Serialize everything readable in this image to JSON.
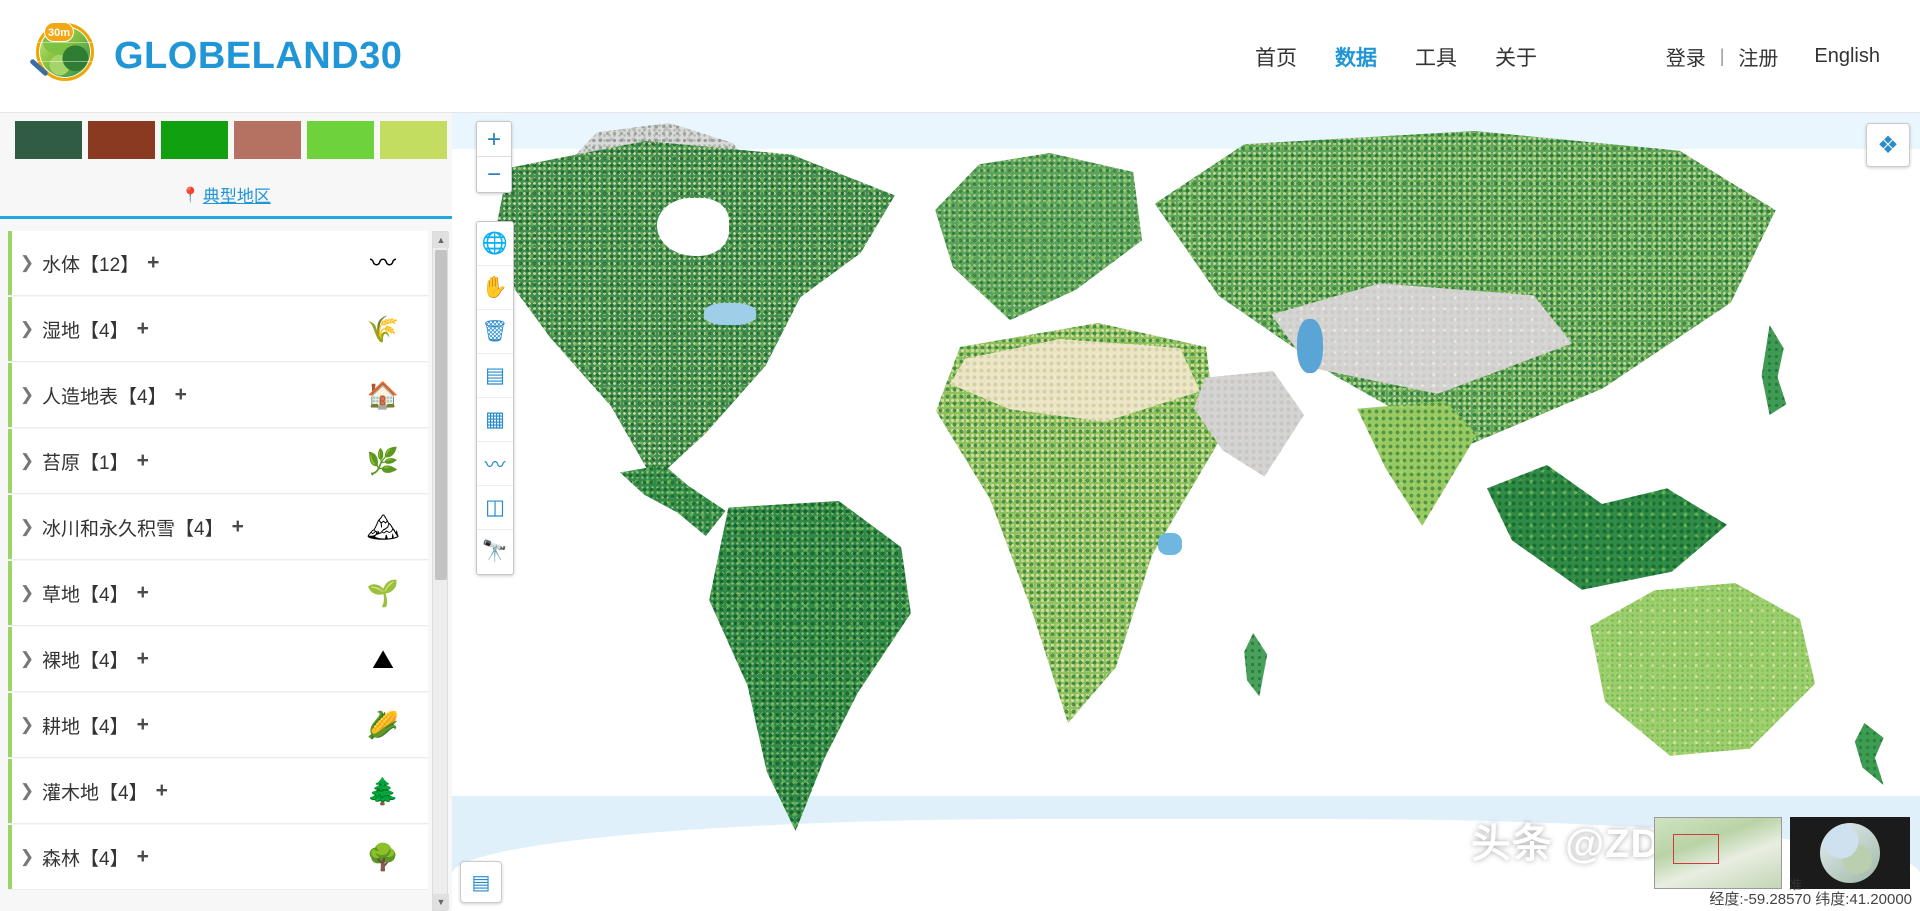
{
  "header": {
    "logo_text": "GLOBELAND30",
    "logo_badge": "30m",
    "nav": [
      {
        "label": "首页",
        "active": false
      },
      {
        "label": "数据",
        "active": true
      },
      {
        "label": "工具",
        "active": false
      },
      {
        "label": "关于",
        "active": false
      }
    ],
    "login": "登录",
    "separator": "|",
    "register": "注册",
    "language": "English"
  },
  "sidebar": {
    "swatches": [
      "#2f5c43",
      "#8a3a20",
      "#10a010",
      "#b57161",
      "#6ed33a",
      "#c3dd60"
    ],
    "typical_area": {
      "pin": "📍",
      "label": "典型地区"
    },
    "categories": [
      {
        "label": "水体【12】",
        "plus": "+",
        "icon": "〰",
        "accent": "#9ed36a"
      },
      {
        "label": "湿地【4】",
        "plus": "+",
        "icon": "🌾",
        "accent": "#9ed36a"
      },
      {
        "label": "人造地表【4】",
        "plus": "+",
        "icon": "🏠",
        "accent": "#9ed36a"
      },
      {
        "label": "苔原【1】",
        "plus": "+",
        "icon": "🌿",
        "accent": "#9ed36a"
      },
      {
        "label": "冰川和永久积雪【4】",
        "plus": "+",
        "icon": "🏔",
        "accent": "#9ed36a"
      },
      {
        "label": "草地【4】",
        "plus": "+",
        "icon": "🌱",
        "accent": "#9ed36a"
      },
      {
        "label": "裸地【4】",
        "plus": "+",
        "icon": "⛰",
        "accent": "#9ed36a"
      },
      {
        "label": "耕地【4】",
        "plus": "+",
        "icon": "🌽",
        "accent": "#9ed36a"
      },
      {
        "label": "灌木地【4】",
        "plus": "+",
        "icon": "🌲",
        "accent": "#9ed36a"
      },
      {
        "label": "森林【4】",
        "plus": "+",
        "icon": "🌳",
        "accent": "#9ed36a"
      }
    ],
    "collapse_icon": "◀"
  },
  "map": {
    "zoom_in": "+",
    "zoom_out": "−",
    "tools": [
      {
        "name": "globe-tool",
        "glyph": "🌐"
      },
      {
        "name": "pan-tool",
        "glyph": "✋"
      },
      {
        "name": "delete-tool",
        "glyph": "🗑"
      },
      {
        "name": "measure-area-tool",
        "glyph": "▤"
      },
      {
        "name": "measure-distance-tool",
        "glyph": "▦"
      },
      {
        "name": "polyline-tool",
        "glyph": "〰"
      },
      {
        "name": "swipe-tool",
        "glyph": "◫"
      },
      {
        "name": "binoculars-tool",
        "glyph": "🔭"
      }
    ],
    "layers_icon": "❖",
    "legend_icon": "▤",
    "scale_label": "准",
    "coordinates": "经度:-59.28570   纬度:41.20000",
    "watermark": "头条 @ZDYGIS"
  }
}
